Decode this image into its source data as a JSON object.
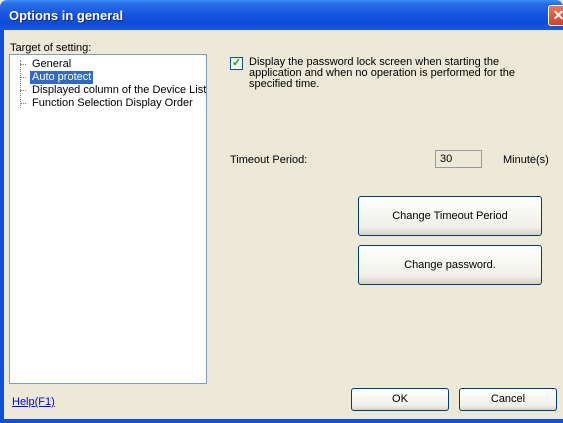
{
  "window": {
    "title": "Options in general",
    "close_glyph": "✕"
  },
  "target_label": "Target of setting:",
  "tree": {
    "items": [
      {
        "label": "General",
        "selected": false
      },
      {
        "label": "Auto protect",
        "selected": true
      },
      {
        "label": "Displayed column of the Device List",
        "selected": false
      },
      {
        "label": "Function Selection Display Order",
        "selected": false
      }
    ]
  },
  "lock_option": {
    "checked": true,
    "check_glyph": "✓",
    "text": "Display the password lock screen when starting the application and when no operation is performed for the specified time."
  },
  "timeout": {
    "label": "Timeout Period:",
    "value": "30",
    "unit": "Minute(s)"
  },
  "buttons": {
    "change_timeout": "Change Timeout Period",
    "change_password": "Change password.",
    "ok": "OK",
    "cancel": "Cancel"
  },
  "help_link": "Help(F1)"
}
